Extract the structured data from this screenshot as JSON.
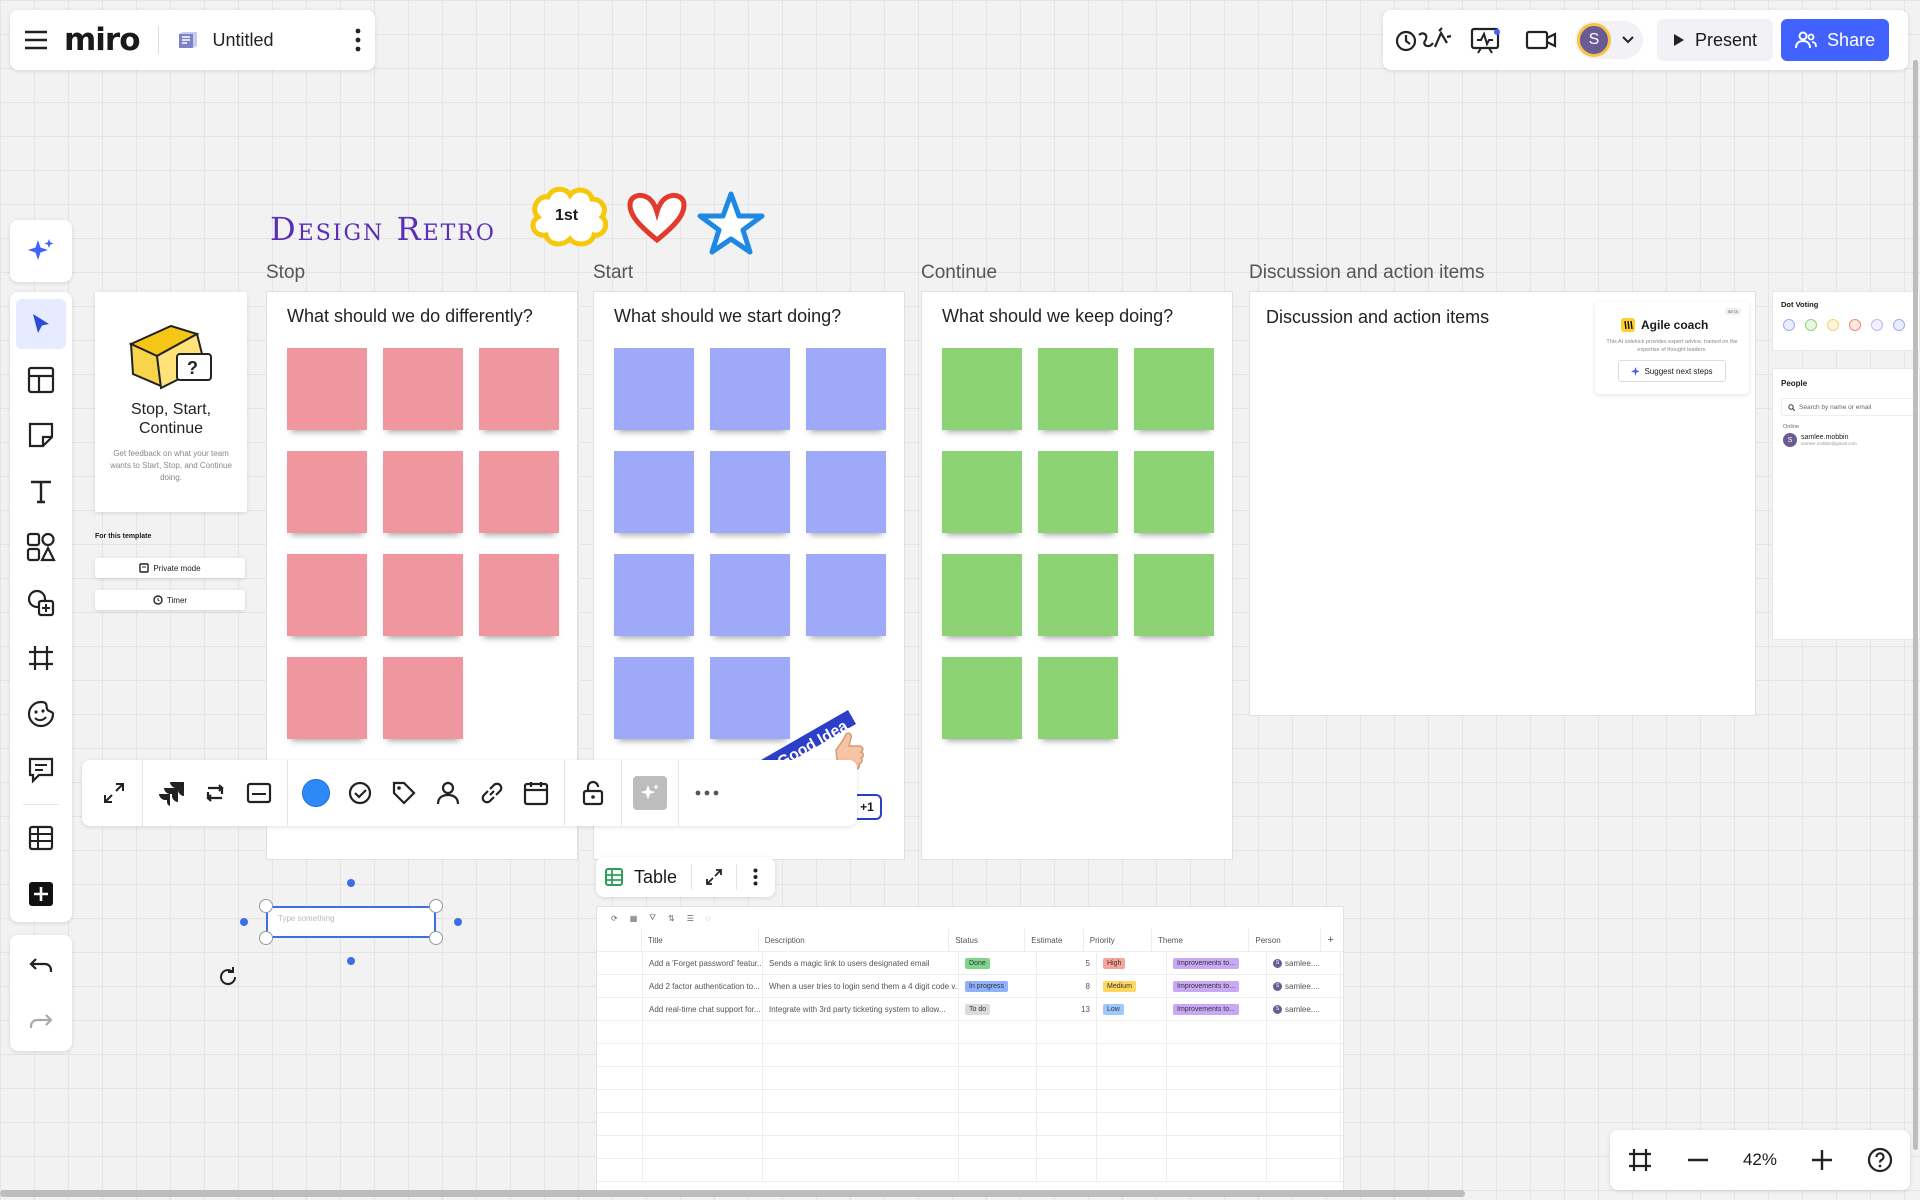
{
  "topbar": {
    "board_title": "Untitled",
    "logo_text": "miro",
    "present_label": "Present",
    "share_label": "Share",
    "avatar_initial": "S"
  },
  "board": {
    "title": "Design Retro",
    "stickers": {
      "first_badge": "1st",
      "good_idea": "Good Idea",
      "plus_count": "+1"
    },
    "template_card": {
      "title": "Stop, Start, Continue",
      "description": "Get feedback on what your team wants to Start, Stop, and Continue doing.",
      "section_label": "For this template",
      "private_mode": "Private mode",
      "timer": "Timer"
    },
    "frames": [
      {
        "label": "Stop",
        "question": "What should we do differently?",
        "color": "#f0969f",
        "count": 11
      },
      {
        "label": "Start",
        "question": "What should we start doing?",
        "color": "#9ea9fa",
        "count": 11
      },
      {
        "label": "Continue",
        "question": "What should we keep doing?",
        "color": "#8ed276",
        "count": 11
      },
      {
        "label": "Discussion and action items",
        "question": "Discussion and action items"
      }
    ],
    "agile_coach": {
      "title": "Agile coach",
      "badge": "BETA",
      "description": "This AI sidekick provides expert advice, trained on the expertise of thought leaders.",
      "button": "Suggest next steps"
    },
    "dot_voting": {
      "title": "Dot Voting",
      "dot_colors": [
        "#9ea9fa",
        "#8ed276",
        "#f5d36b",
        "#f08a6b",
        "#c6b4f7",
        "#9ea9fa"
      ]
    },
    "people": {
      "title": "People",
      "search_placeholder": "Search by name or email",
      "online_label": "Online",
      "user_name": "samlee.mobbin",
      "user_email": "samlee.mobbin@gmail.com"
    },
    "text_input_placeholder": "Type something"
  },
  "table": {
    "label": "Table",
    "columns": [
      "Title",
      "Description",
      "Status",
      "Estimate",
      "Priority",
      "Theme",
      "Person"
    ],
    "rows": [
      {
        "title": "Add a 'Forget password' featur...",
        "description": "Sends a magic link to users designated email",
        "status": "Done",
        "status_color": "#7fd58b",
        "estimate": "5",
        "priority": "High",
        "priority_color": "#f9a39a",
        "theme": "Improvements to...",
        "person": "samlee...."
      },
      {
        "title": "Add 2 factor authentication to...",
        "description": "When a user tries to login send them a 4 digit code v...",
        "status": "In progress",
        "status_color": "#8fb2ff",
        "estimate": "8",
        "priority": "Medium",
        "priority_color": "#ffd75e",
        "theme": "Improvements to...",
        "person": "samlee...."
      },
      {
        "title": "Add real-time chat support for...",
        "description": "Integrate with 3rd party ticketing system to allow...",
        "status": "To do",
        "status_color": "#dcdcdc",
        "estimate": "13",
        "priority": "Low",
        "priority_color": "#9ec6ff",
        "theme": "Improvements to...",
        "person": "samlee...."
      }
    ],
    "theme_color": "#c9a8f5"
  },
  "zoom": {
    "level": "42%"
  },
  "colors": {
    "accent": "#4262ff",
    "title_purple": "#5b2fb5",
    "selected_fill": "#2b8af7"
  }
}
